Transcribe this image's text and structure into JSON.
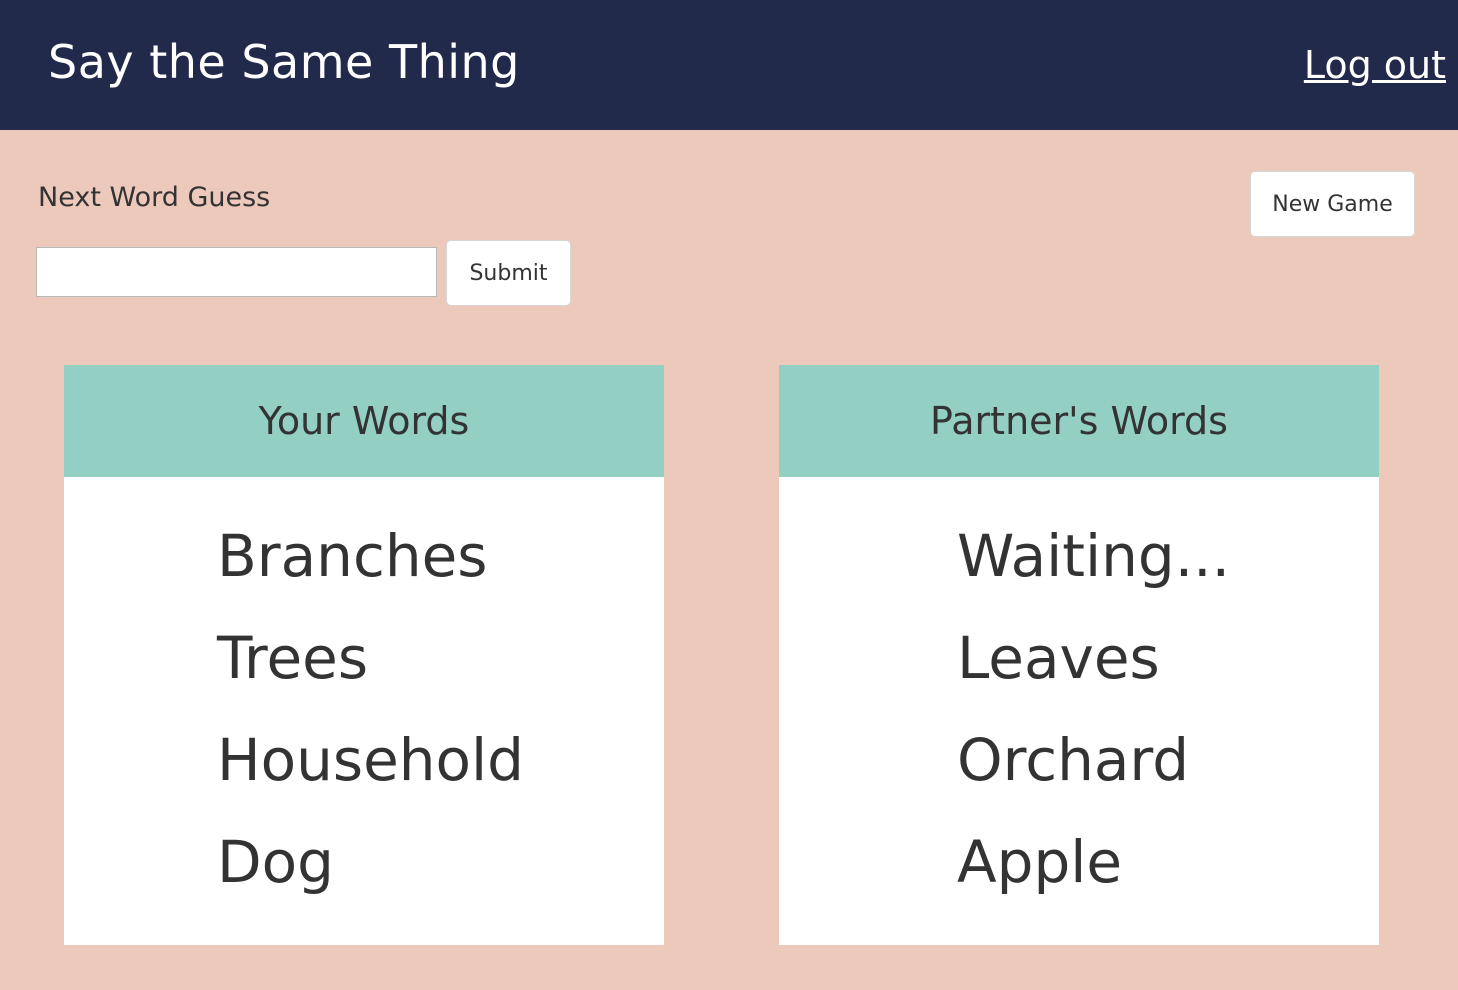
{
  "navbar": {
    "brand": "Say the Same Thing",
    "logout_label": "Log out"
  },
  "guess": {
    "label": "Next Word Guess",
    "input_value": "",
    "submit_label": "Submit"
  },
  "new_game_label": "New Game",
  "your_words": {
    "title": "Your Words",
    "words": [
      "Branches",
      "Trees",
      "Household",
      "Dog"
    ]
  },
  "partner_words": {
    "title": "Partner's Words",
    "words": [
      "Waiting...",
      "Leaves",
      "Orchard",
      "Apple"
    ]
  },
  "colors": {
    "navbar": "#212a4a",
    "background": "#edc9bc",
    "panel_header": "#93d0c3",
    "panel_body": "#ffffff",
    "text": "#333333"
  }
}
